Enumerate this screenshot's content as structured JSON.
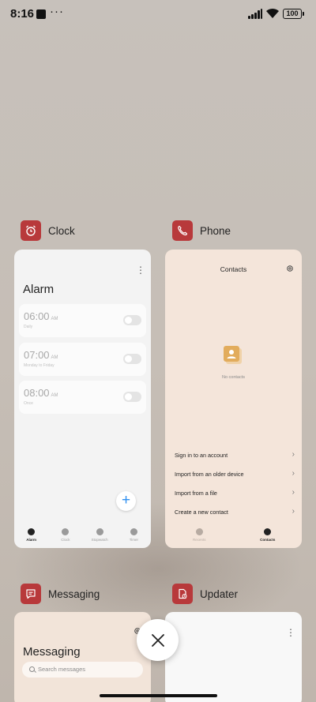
{
  "status_bar": {
    "time": "8:16",
    "overflow": "···",
    "battery": "100"
  },
  "apps": {
    "clock": {
      "name": "Clock",
      "icon": "alarm-clock-icon",
      "title": "Alarm",
      "alarms": [
        {
          "time": "06:00",
          "ampm": "AM",
          "sub": "Daily"
        },
        {
          "time": "07:00",
          "ampm": "AM",
          "sub": "Monday to Friday"
        },
        {
          "time": "08:00",
          "ampm": "AM",
          "sub": "Once"
        }
      ],
      "add_label": "+",
      "nav": [
        "Alarm",
        "Clock",
        "Stopwatch",
        "Timer"
      ]
    },
    "phone": {
      "name": "Phone",
      "icon": "phone-icon",
      "title": "Contacts",
      "empty_text": "No contacts",
      "actions": [
        "Sign in to an account",
        "Import from an older device",
        "Import from a file",
        "Create a new contact"
      ],
      "nav": [
        "Recents",
        "Contacts"
      ]
    },
    "messaging": {
      "name": "Messaging",
      "icon": "message-icon",
      "title": "Messaging",
      "search_placeholder": "Search messages"
    },
    "updater": {
      "name": "Updater",
      "icon": "updater-icon"
    }
  },
  "colors": {
    "app_icon_bg": "#b8393b",
    "accent": "#2e8ff0"
  }
}
